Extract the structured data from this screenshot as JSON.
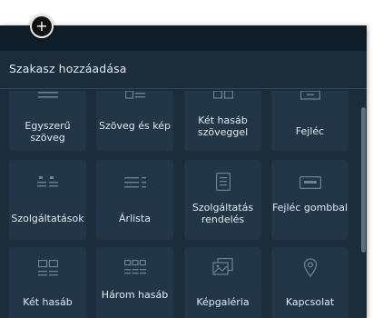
{
  "header": {
    "title": "Szakasz hozzáadása"
  },
  "add_button": {
    "label": "+"
  },
  "rows": [
    [
      {
        "label": "Egyszerű szöveg",
        "icon": "text-lines-icon"
      },
      {
        "label": "Szöveg és kép",
        "icon": "image-text-icon"
      },
      {
        "label": "Két hasáb szöveggel",
        "icon": "two-column-text-icon"
      },
      {
        "label": "Fejléc",
        "icon": "header-icon"
      }
    ],
    [
      {
        "label": "Szolgáltatások",
        "icon": "services-icon"
      },
      {
        "label": "Árlista",
        "icon": "price-list-icon"
      },
      {
        "label": "Szolgáltatás rendelés",
        "icon": "service-order-icon"
      },
      {
        "label": "Fejléc gombbal",
        "icon": "header-button-icon"
      }
    ],
    [
      {
        "label": "Két hasáb",
        "icon": "two-column-icon"
      },
      {
        "label": "Három hasáb",
        "icon": "three-column-icon"
      },
      {
        "label": "Képgaléria",
        "icon": "image-gallery-icon"
      },
      {
        "label": "Kapcsolat",
        "icon": "location-pin-icon"
      }
    ]
  ],
  "colors": {
    "panel_bg": "#1b2c3a",
    "tile_bg": "#223648",
    "text": "#e2e9ef",
    "icon": "#6d8191"
  }
}
